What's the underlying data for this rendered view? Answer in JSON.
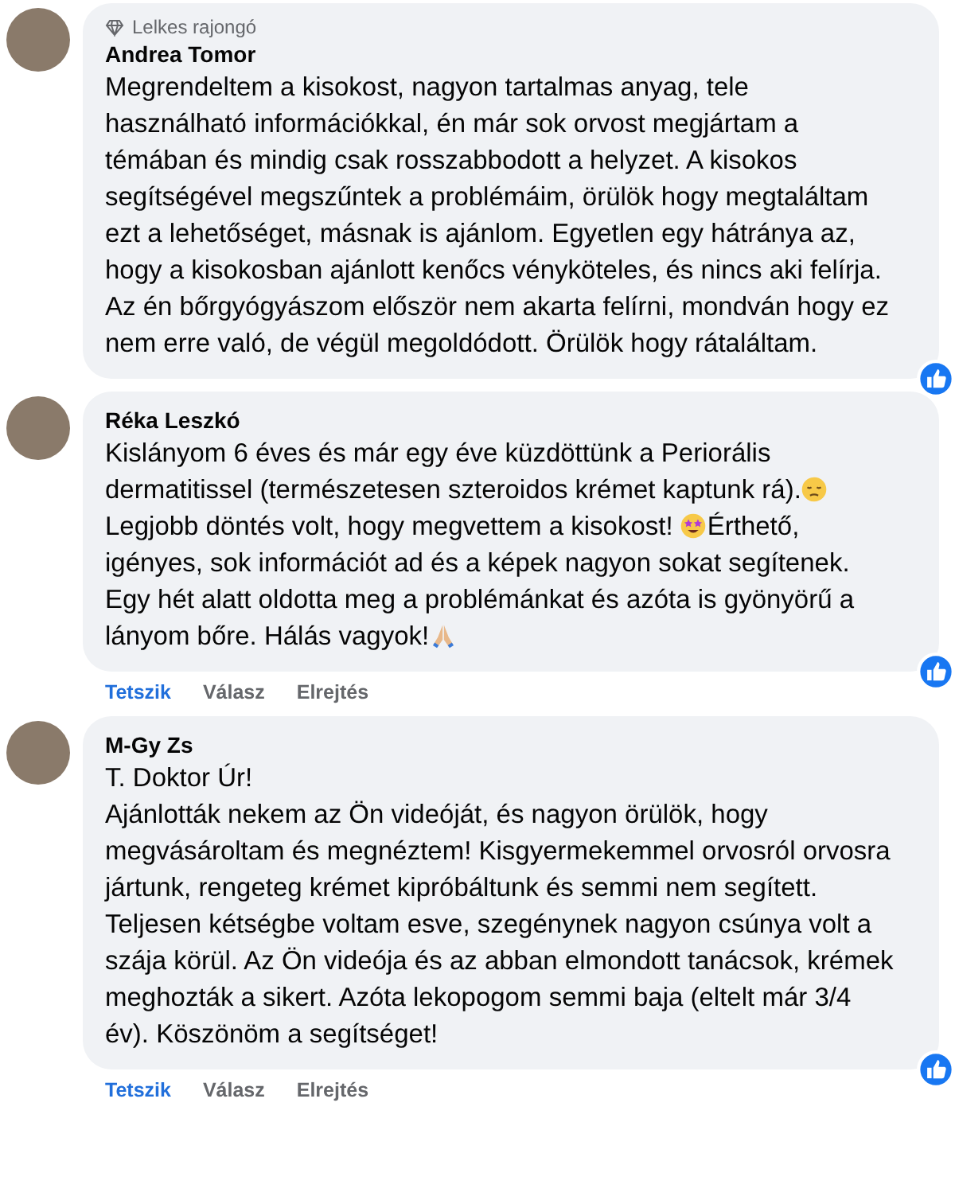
{
  "comments": [
    {
      "badge": "Lelkes rajongó",
      "author": "Andrea Tomor",
      "paragraphs": [
        [
          {
            "text": "Megrendeltem a kisokost, nagyon tartalmas anyag, tele használható információkkal, én már sok orvost megjártam a témában és mindig csak rosszabbodott a helyzet. A kisokos segítségével megszűntek a problémáim, örülök hogy megtaláltam ezt a lehetőséget, másnak is ajánlom. Egyetlen egy hátránya az, hogy a kisokosban ajánlott kenőcs vényköteles, és nincs aki felírja. Az én bőrgyógyászom először nem akarta felírni, mondván hogy ez nem erre való, de végül megoldódott. Örülök hogy rátaláltam."
          }
        ]
      ]
    },
    {
      "author": "Réka Leszkó",
      "paragraphs": [
        [
          {
            "text": "Kislányom 6 éves és már egy éve küzdöttünk a Periorális dermatitissel (természetesen szteroidos krémet kaptunk rá)."
          },
          {
            "kind": "pensive-emoji"
          },
          {
            "text": " Legjobb döntés volt, hogy megvettem a kisokost! "
          },
          {
            "kind": "star-eyes-emoji"
          },
          {
            "text": "Érthető, igényes, sok információt ad és a képek nagyon sokat segítenek. Egy hét alatt oldotta meg a problémánkat és azóta is gyönyörű a lányom bőre. Hálás vagyok!"
          },
          {
            "kind": "praying-emoji"
          }
        ]
      ],
      "actions": [
        {
          "label": "Tetszik",
          "kind": "like"
        },
        {
          "label": "Válasz",
          "kind": "reply"
        },
        {
          "label": "Elrejtés",
          "kind": "hide"
        }
      ]
    },
    {
      "author": "M-Gy Zs",
      "paragraphs": [
        [
          {
            "text": "T. Doktor Úr!"
          }
        ],
        [
          {
            "text": "Ajánlották nekem az Ön videóját, és nagyon örülök, hogy megvásároltam és megnéztem! Kisgyermekemmel orvosról orvosra jártunk, rengeteg krémet kipróbáltunk és semmi nem segített. Teljesen kétségbe voltam esve, szegénynek nagyon csúnya volt a szája körül. Az Ön videója és az abban elmondott tanácsok, krémek meghozták a sikert. Azóta lekopogom semmi baja (eltelt már 3/4 év). Köszönöm a segítséget!"
          }
        ]
      ],
      "actions": [
        {
          "label": "Tetszik",
          "kind": "like"
        },
        {
          "label": "Válasz",
          "kind": "reply"
        },
        {
          "label": "Elrejtés",
          "kind": "hide"
        }
      ]
    }
  ]
}
